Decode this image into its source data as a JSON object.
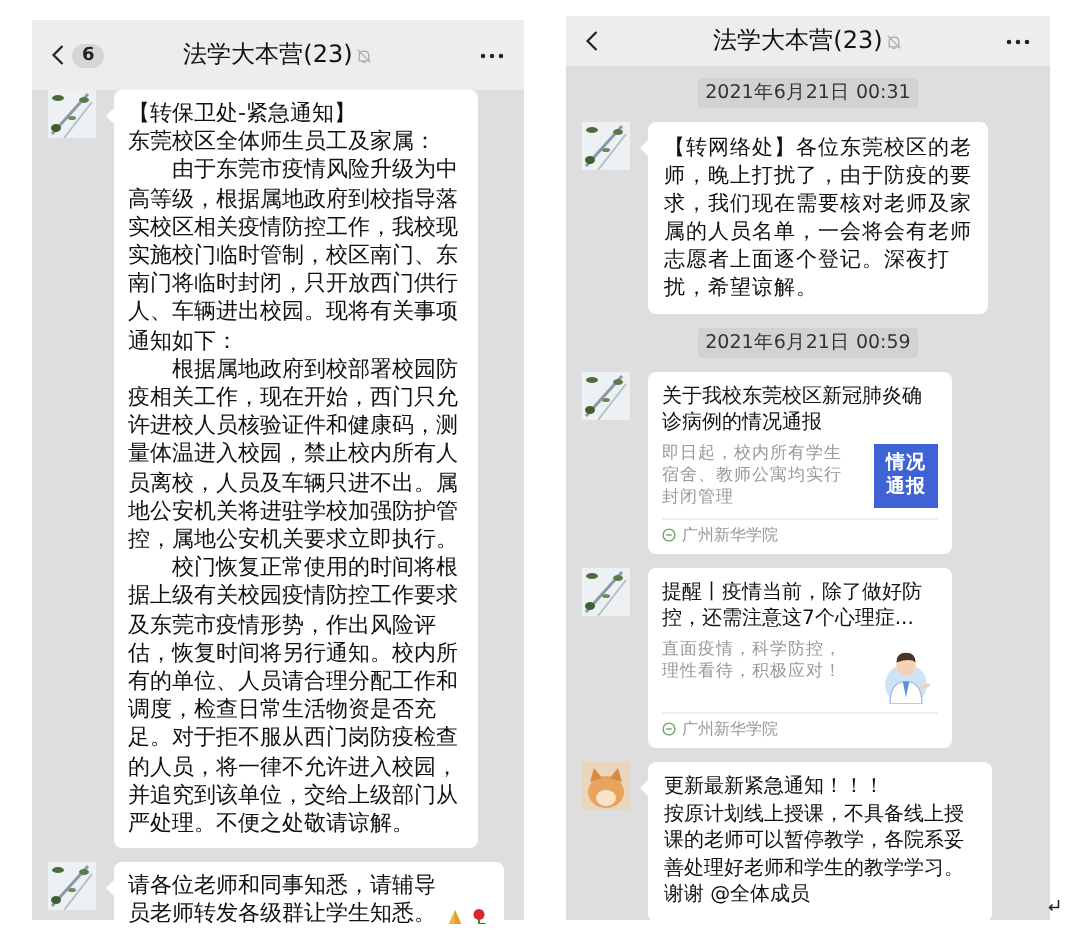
{
  "panels": [
    {
      "header": {
        "unread": "6",
        "title": "法学大本营(23)",
        "muted": true
      },
      "messages": [
        {
          "kind": "text",
          "avatar": {
            "kind": "branch"
          },
          "paragraphs": [
            {
              "text": "【转保卫处-紧急通知】",
              "indented": false
            },
            {
              "text": "东莞校区全体师生员工及家属：",
              "indented": false
            },
            {
              "text": "由于东莞市疫情风险升级为中高等级，根据属地政府到校指导落实校区相关疫情防控工作，我校现实施校门临时管制，校区南门、东南门将临时封闭，只开放西门供行人、车辆进出校园。现将有关事项通知如下：",
              "indented": true
            },
            {
              "text": "根据属地政府到校部署校园防疫相关工作，现在开始，西门只允许进校人员核验证件和健康码，测量体温进入校园，禁止校内所有人员离校，人员及车辆只进不出。属地公安机关将进驻学校加强防护管控，属地公安机关要求立即执行。",
              "indented": true
            },
            {
              "text": "校门恢复正常使用的时间将根据上级有关校园疫情防控工作要求及东莞市疫情形势，作出风险评估，恢复时间将另行通知。校内所有的单位、人员请合理分配工作和调度，检查日常生活物资是否充足。对于拒不服从西门岗防疫检查的人员，将一律不允许进入校园，并追究到该单位，交给上级部门从严处理。不便之处敬请谅解。",
              "indented": true
            }
          ]
        },
        {
          "kind": "text",
          "avatar": {
            "kind": "branch"
          },
          "paragraphs": [
            {
              "text": "请各位老师和同事知悉，请辅导员老师转发各级群让学生知悉。",
              "indented": false
            }
          ],
          "trailing_icons": [
            {
              "kind": "pray"
            },
            {
              "kind": "rose"
            }
          ]
        }
      ]
    },
    {
      "header": {
        "title": "法学大本营(23)",
        "muted": true
      },
      "messages": [
        {
          "kind": "timestamp",
          "text": "2021年6月21日 00:31"
        },
        {
          "kind": "text",
          "avatar": {
            "kind": "branch"
          },
          "paragraphs": [
            {
              "text": "【转网络处】各位东莞校区的老师，晚上打扰了，由于防疫的要求，我们现在需要核对老师及家属的人员名单，一会将会有老师志愿者上面逐个登记。深夜打扰，希望谅解。",
              "indented": false
            }
          ]
        },
        {
          "kind": "timestamp",
          "text": "2021年6月21日 00:59"
        },
        {
          "kind": "link",
          "avatar": {
            "kind": "branch"
          },
          "title": "关于我校东莞校区新冠肺炎确诊病例的情况通报",
          "description": "即日起，校内所有学生宿舍、教师公寓均实行封闭管理",
          "thumb": {
            "kind": "banner",
            "text": [
              "情况",
              "通报"
            ]
          },
          "source": "广州新华学院"
        },
        {
          "kind": "link",
          "avatar": {
            "kind": "branch"
          },
          "title": "提醒丨疫情当前，除了做好防控，还需注意这7个心理症...",
          "description": "直面疫情，科学防控，理性看待，积极应对！",
          "thumb": {
            "kind": "doctor"
          },
          "source": "广州新华学院"
        },
        {
          "kind": "text",
          "avatar": {
            "kind": "cat"
          },
          "paragraphs": [
            {
              "text": "更新最新紧急通知！！！",
              "indented": false
            },
            {
              "text": "按原计划线上授课，不具备线上授课的老师可以暂停教学，各院系妥善处理好老师和学生的教学学习。谢谢 @全体成员",
              "indented": false
            }
          ]
        }
      ]
    }
  ]
}
